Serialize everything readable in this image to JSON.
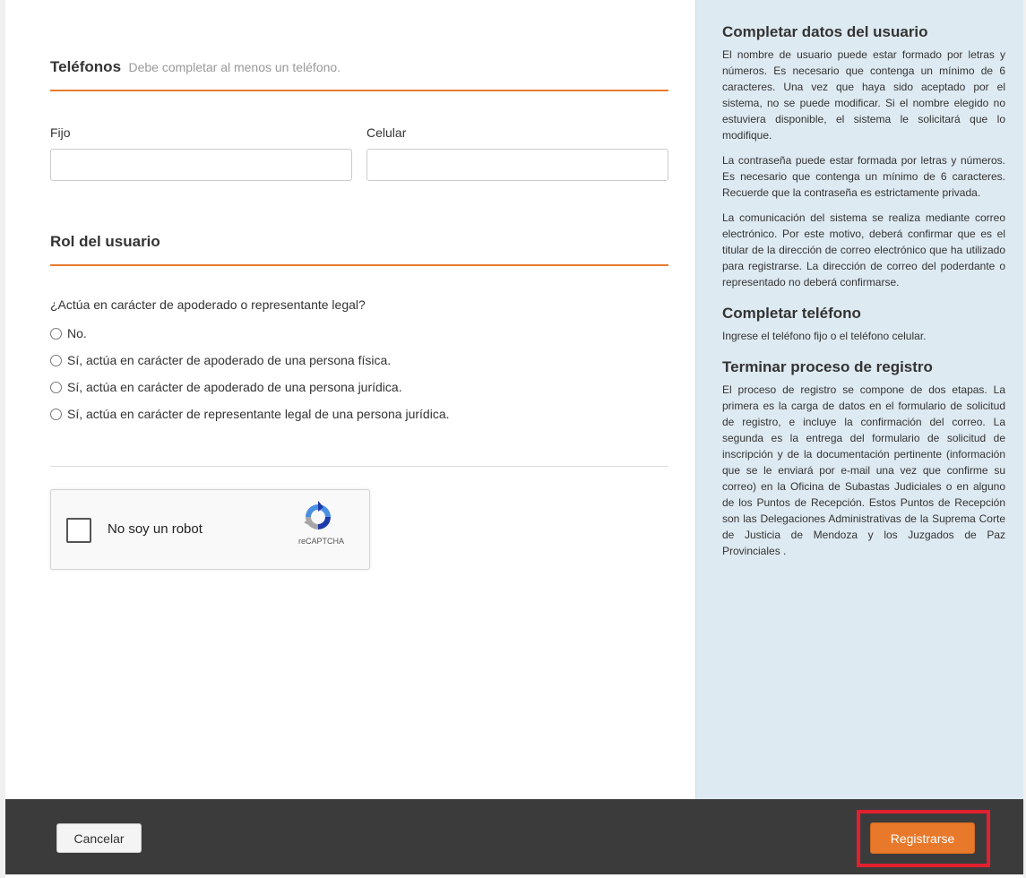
{
  "telefonos": {
    "title": "Teléfonos",
    "hint": "Debe completar al menos un teléfono.",
    "fijo_label": "Fijo",
    "fijo_value": "",
    "celular_label": "Celular",
    "celular_value": ""
  },
  "rol": {
    "title": "Rol del usuario",
    "question": "¿Actúa en carácter de apoderado o representante legal?",
    "options": [
      "No.",
      "Sí, actúa en carácter de apoderado de una persona física.",
      "Sí, actúa en carácter de apoderado de una persona jurídica.",
      "Sí, actúa en carácter de representante legal de una persona jurídica."
    ]
  },
  "captcha": {
    "label": "No soy un robot",
    "brand": "reCAPTCHA"
  },
  "help": {
    "usuario_title": "Completar datos del usuario",
    "usuario_p1": "El nombre de usuario puede estar formado por letras y números. Es necesario que contenga un mínimo de 6 caracteres. Una vez que haya sido aceptado por el sistema, no se puede modificar. Si el nombre elegido no estuviera disponible, el sistema le solicitará que lo modifique.",
    "usuario_p2": "La contraseña puede estar formada por letras y números. Es necesario que contenga un mínimo de 6 caracteres. Recuerde que la contraseña es estrictamente privada.",
    "usuario_p3": "La comunicación del sistema se realiza mediante correo electrónico. Por este motivo, deberá confirmar que es el titular de la dirección de correo electrónico que ha utilizado para registrarse. La dirección de correo del poderdante o representado no deberá confirmarse.",
    "telefono_title": "Completar teléfono",
    "telefono_p": "Ingrese el teléfono fijo o el teléfono celular.",
    "registro_title": "Terminar proceso de registro",
    "registro_p": "El proceso de registro se compone de dos etapas. La primera es la carga de datos en el formulario de solicitud de registro, e incluye la confirmación del correo. La segunda es la entrega del formulario de solicitud de inscripción y de la documentación pertinente (información que se le enviará por e-mail una vez que confirme su correo) en la Oficina de Subastas Judiciales o en alguno de los Puntos de Recepción. Estos Puntos de Recepción son las Delegaciones Administrativas de la Suprema Corte de Justicia de Mendoza y los Juzgados de Paz Provinciales ."
  },
  "footer": {
    "cancel_label": "Cancelar",
    "register_label": "Registrarse"
  },
  "colors": {
    "accent": "#e8782a",
    "highlight": "#e2202f",
    "help_bg": "#deeaf2",
    "footer_bg": "#3b3b3b"
  }
}
